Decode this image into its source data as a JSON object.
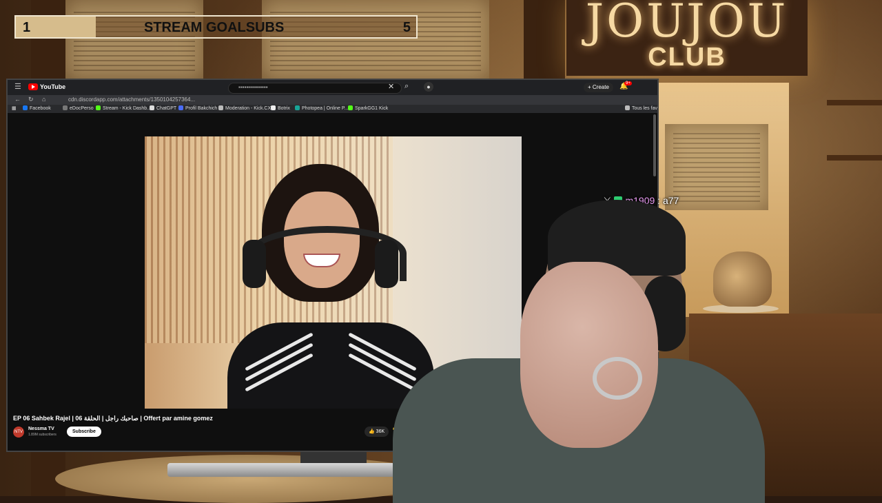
{
  "goal": {
    "current": "1",
    "title": "STREAM GOALSUBS",
    "target": "5",
    "progress": 0.2
  },
  "sign": {
    "title": "JOUJOU",
    "subtitle": "CLUB"
  },
  "browser": {
    "app_name": "YouTube",
    "address": "cdn.discordapp.com/attachments/1350104257364...",
    "create_label": "Create",
    "notification_count": "9+",
    "bookmarks": [
      {
        "label": "Facebook",
        "color": "#1877f2"
      },
      {
        "label": "eDocPerso",
        "color": "#777777"
      },
      {
        "label": "Stream - Kick Dashb...",
        "color": "#53fc18"
      },
      {
        "label": "ChatGPT",
        "color": "#dddddd"
      },
      {
        "label": "Profil Bakchich",
        "color": "#4a6cf7"
      },
      {
        "label": "Moderation - Kick.CX",
        "color": "#bbbbbb"
      },
      {
        "label": "Botrix",
        "color": "#eeeeee"
      },
      {
        "label": "Photopea | Online P...",
        "color": "#18a497"
      },
      {
        "label": "SparkGG1 Kick",
        "color": "#53fc18"
      }
    ],
    "bookmarks_folder": "Tous les fav"
  },
  "video": {
    "title": "EP 06 Sahbek Rajel | صاحبك راجل | الحلقة 06 | Offert par amine gomez",
    "channel": "Nessma TV",
    "subscribers": "1.89M subscribers",
    "subscribe_label": "Subscribe",
    "likes": "36K"
  },
  "chat": {
    "user": "m1909",
    "separator": ":",
    "message": "a77"
  }
}
